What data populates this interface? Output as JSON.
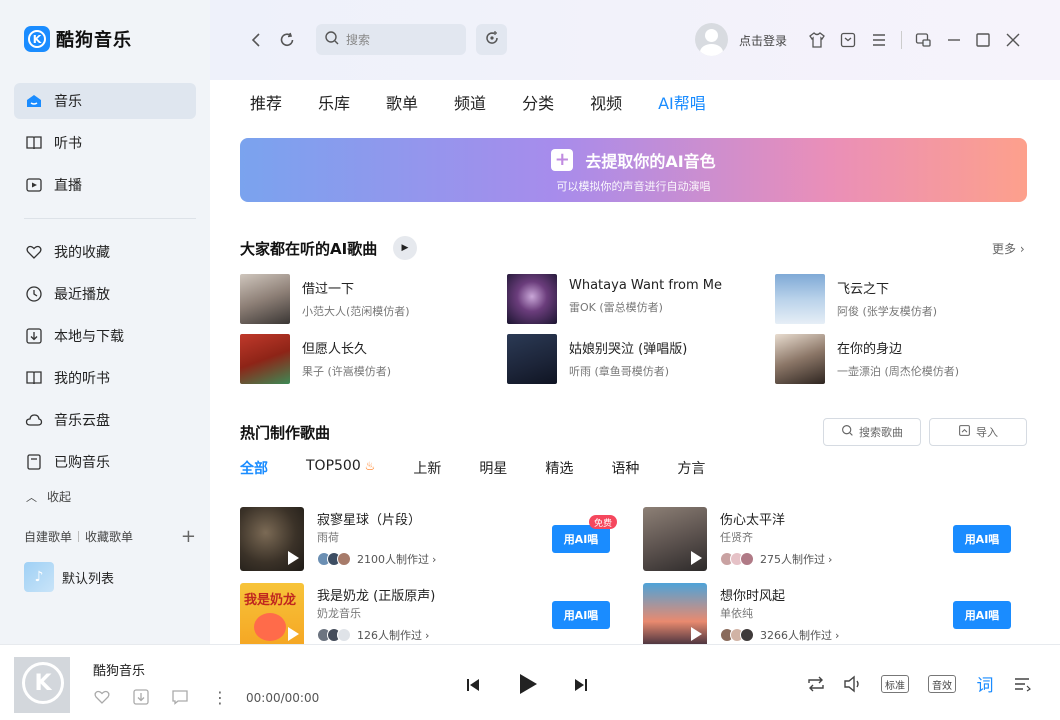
{
  "app": {
    "name": "酷狗音乐",
    "logo_letter": "K"
  },
  "sidebar": {
    "items": [
      {
        "label": "音乐",
        "icon": "home-icon"
      },
      {
        "label": "听书",
        "icon": "book-icon"
      },
      {
        "label": "直播",
        "icon": "live-icon"
      },
      {
        "label": "我的收藏",
        "icon": "heart-icon"
      },
      {
        "label": "最近播放",
        "icon": "clock-icon"
      },
      {
        "label": "本地与下载",
        "icon": "download-icon"
      },
      {
        "label": "我的听书",
        "icon": "book-icon"
      },
      {
        "label": "音乐云盘",
        "icon": "cloud-icon"
      },
      {
        "label": "已购音乐",
        "icon": "purchase-icon"
      }
    ],
    "collapse_label": "收起",
    "created_playlists": "自建歌单",
    "collected_playlists": "收藏歌单",
    "default_list": "默认列表"
  },
  "topbar": {
    "search_placeholder": "搜索",
    "login_label": "点击登录"
  },
  "tabs": [
    "推荐",
    "乐库",
    "歌单",
    "频道",
    "分类",
    "视频",
    "AI帮唱"
  ],
  "banner": {
    "title": "去提取你的AI音色",
    "subtitle": "可以模拟你的声音进行自动演唱"
  },
  "popular": {
    "title": "大家都在听的AI歌曲",
    "more_label": "更多",
    "songs": [
      {
        "name": "借过一下",
        "artist": "小范大人(范闲模仿者)"
      },
      {
        "name": "Whataya Want from Me",
        "artist": "雷OK (雷总模仿者)"
      },
      {
        "name": "飞云之下",
        "artist": "阿俊 (张学友模仿者)"
      },
      {
        "name": "但愿人长久",
        "artist": "果子 (许嵩模仿者)"
      },
      {
        "name": "姑娘别哭泣 (弹唱版)",
        "artist": "听雨 (章鱼哥模仿者)"
      },
      {
        "name": "在你的身边",
        "artist": "一壶漂泊 (周杰伦模仿者)"
      }
    ]
  },
  "hot": {
    "title": "热门制作歌曲",
    "search_label": "搜索歌曲",
    "import_label": "导入",
    "filters": [
      "全部",
      "TOP500",
      "上新",
      "明星",
      "精选",
      "语种",
      "方言"
    ],
    "button_label": "用AI唱",
    "free_badge": "免费",
    "songs": [
      {
        "name": "寂寥星球（片段）",
        "artist": "雨荷",
        "count": "2100人制作过"
      },
      {
        "name": "伤心太平洋",
        "artist": "任贤齐",
        "count": "275人制作过"
      },
      {
        "name": "我是奶龙 (正版原声)",
        "artist": "奶龙音乐",
        "count": "126人制作过"
      },
      {
        "name": "想你时风起",
        "artist": "单依纯",
        "count": "3266人制作过"
      }
    ],
    "cover_text": "我是奶龙"
  },
  "player": {
    "title": "酷狗音乐",
    "time": "00:00/00:00",
    "quality_label": "标准",
    "effect_label": "音效",
    "lyrics_label": "词"
  },
  "colors": {
    "accent": "#1a8cff",
    "badge": "#f5475d"
  }
}
